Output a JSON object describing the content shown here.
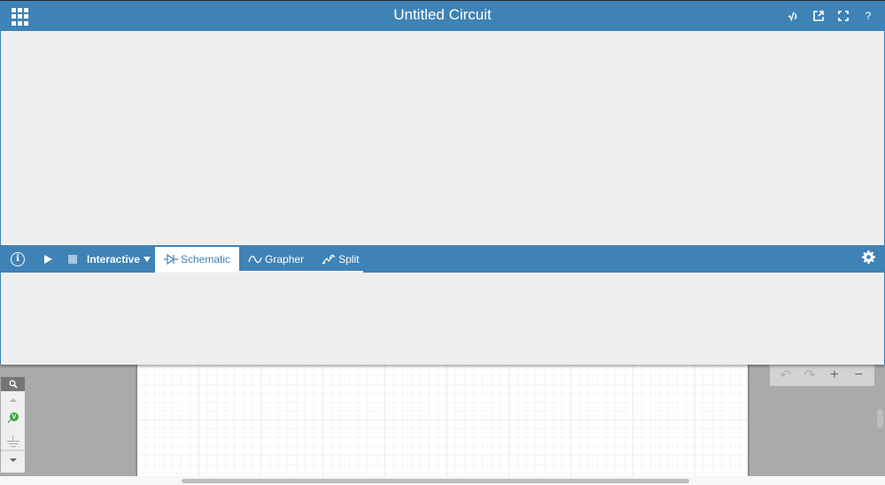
{
  "header": {
    "title": "Untitled Circuit",
    "icons": [
      "apps-grid-icon",
      "sqrt-sound-icon",
      "export-icon",
      "fullscreen-icon",
      "help-icon"
    ],
    "help_label": "?"
  },
  "toolbar": {
    "mode_label": "Interactive",
    "info_label": "i",
    "tabs": [
      {
        "label": "Schematic",
        "icon": "diode-icon",
        "active": true
      },
      {
        "label": "Grapher",
        "icon": "sine-wave-icon",
        "active": false
      },
      {
        "label": "Split",
        "icon": "split-icon",
        "active": false
      }
    ]
  },
  "parts_bar": {
    "probe_label": "V"
  },
  "edit_tools": {
    "undo": "↶",
    "redo": "↷",
    "zoom_in": "+",
    "zoom_out": "−"
  },
  "colors": {
    "brand": "#3f82b6",
    "panel_bg": "#eeeeee",
    "workspace_bg": "#aaaaaa",
    "probe": "#3ea83e"
  }
}
